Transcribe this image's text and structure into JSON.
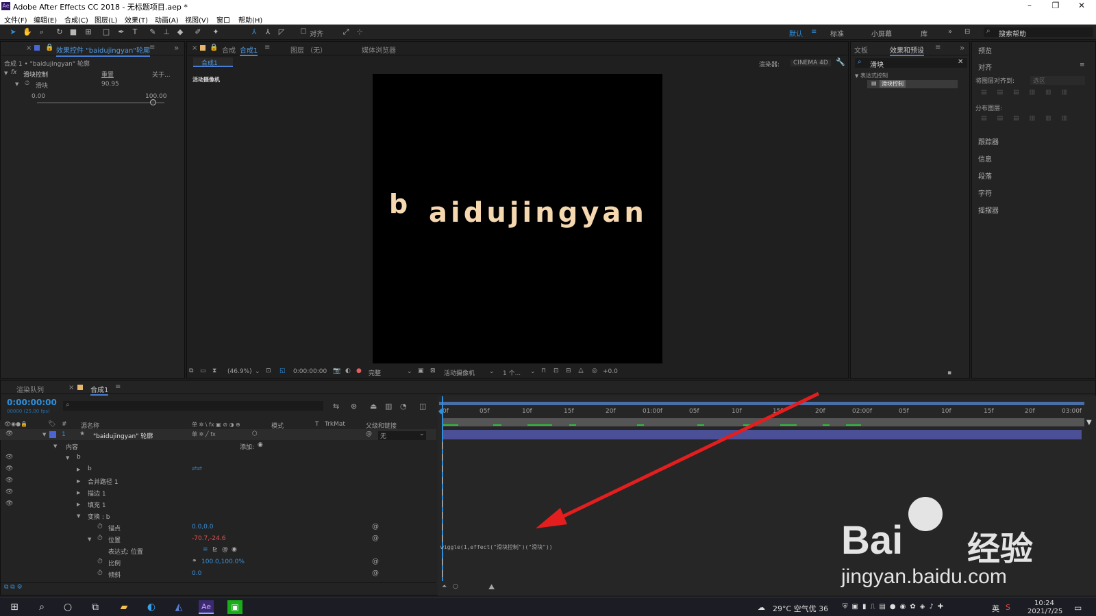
{
  "window": {
    "title": "Adobe After Effects CC 2018 - 无标题项目.aep *",
    "app_icon": "Ae"
  },
  "menu": [
    "文件(F)",
    "编辑(E)",
    "合成(C)",
    "图层(L)",
    "效果(T)",
    "动画(A)",
    "视图(V)",
    "窗口",
    "帮助(H)"
  ],
  "toolbar": {
    "align_label": "对齐",
    "workspaces": [
      "默认",
      "标准",
      "小屏幕",
      "库"
    ],
    "search_placeholder": "搜索帮助"
  },
  "effect_controls": {
    "tab_label": "效果控件 \"baidujingyan\"轮廓",
    "header": "合成 1 • \"baidujingyan\" 轮廓",
    "effect_name": "滑块控制",
    "reset_label": "重置",
    "about_label": "关于...",
    "slider_label": "滑块",
    "slider_value": "90.95",
    "range_min": "0.00",
    "range_max": "100.00",
    "slider_fraction": 0.91
  },
  "composition_panel": {
    "tab_prefix": "合成",
    "tab_label": "合成1",
    "layer_tab": "图层 （无）",
    "media_browser": "媒体浏览器",
    "subtab": "合成1",
    "renderer_label": "渲染器:",
    "renderer_value": "CINEMA 4D",
    "camera_label": "活动摄像机",
    "zoom": "(46.9%)",
    "timecode": "0:00:00:00",
    "quality": "完整",
    "view_camera": "活动摄像机",
    "views": "1 个...",
    "exposure": "+0.0"
  },
  "canvas": {
    "text_b": "b",
    "text_rest": "aidujingyan"
  },
  "effects_presets": {
    "tab_text": "文板",
    "tab_label": "效果和预设",
    "search_value": "滑块",
    "category": "表达式控制",
    "item": "滑块控制"
  },
  "right_panels": {
    "preview": "预览",
    "align": "对齐",
    "align_to_label": "将图层对齐到:",
    "align_to_value": "选区",
    "distribute_label": "分布图层:",
    "items": [
      "跟踪器",
      "信息",
      "段落",
      "字符",
      "摇摆器"
    ]
  },
  "timeline": {
    "render_queue_tab": "渲染队列",
    "comp_tab": "合成1",
    "timecode": "0:00:00:00",
    "fps": "00000 (25.00 fps)",
    "col_source_name": "源名称",
    "col_mode": "模式",
    "col_t": "T",
    "col_trkmat": "TrkMat",
    "col_parent": "父级和链接",
    "layer_number": "1",
    "layer_name": "\"baidujingyan\" 轮廓",
    "parent_value": "无",
    "content_label": "内容",
    "add_label": "添加:",
    "tree": [
      {
        "label": "b",
        "indent": 0
      },
      {
        "label": "b",
        "indent": 1
      },
      {
        "label": "合并路径 1",
        "indent": 1
      },
      {
        "label": "描边 1",
        "indent": 1
      },
      {
        "label": "填充 1",
        "indent": 1
      },
      {
        "label": "变换 : b",
        "indent": 1
      }
    ],
    "props": [
      {
        "name": "锚点",
        "value": "0.0,0.0"
      },
      {
        "name": "位置",
        "value": "-70.7,-24.6"
      },
      {
        "name": "比例",
        "value": "100.0,100.0%"
      },
      {
        "name": "倾斜",
        "value": "0.0"
      }
    ],
    "expression_label": "表达式: 位置",
    "expression_text": "wiggle(1,effect(\"滑块控制\")(\"滑块\"))",
    "ruler_ticks": [
      "0f",
      "05f",
      "10f",
      "15f",
      "20f",
      "01:00f",
      "05f",
      "10f",
      "15f",
      "20f",
      "02:00f",
      "05f",
      "10f",
      "15f",
      "20f",
      "03:00f"
    ]
  },
  "watermark": {
    "brand": "Bai",
    "brand_cn": "经验",
    "url": "jingyan.baidu.com"
  },
  "taskbar": {
    "weather": "29°C 空气优 36",
    "ime": "英",
    "time": "10:24",
    "date": "2021/7/25"
  },
  "colors": {
    "accent_blue": "#2f8fdb",
    "expression_red": "#e05252",
    "layer_bar": "#4a4f96",
    "arrow": "#e41e1e",
    "canvas_text": "#f5d7b0"
  }
}
